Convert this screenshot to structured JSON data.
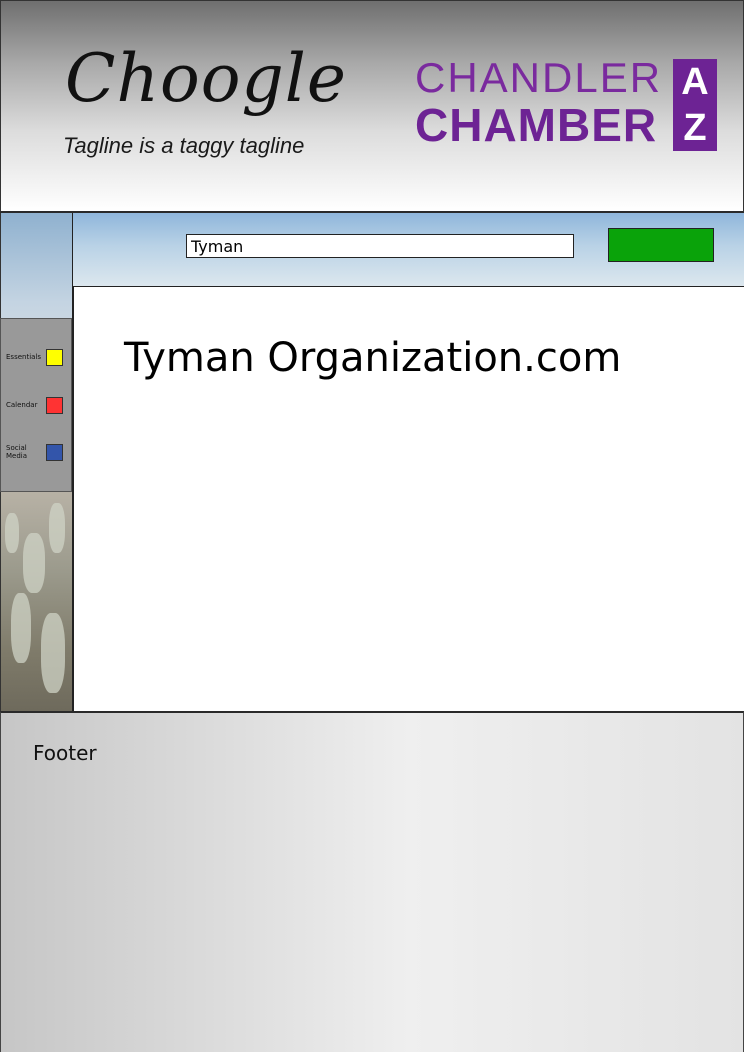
{
  "header": {
    "site_title": "Choogle",
    "tagline": "Tagline is a taggy tagline",
    "brand": {
      "line1": "CHANDLER",
      "line2": "CHAMBER",
      "az_top": "A",
      "az_bottom": "Z",
      "color": "#6d2394"
    }
  },
  "search": {
    "value": "Tyman",
    "button_color": "#0aa30a"
  },
  "sidebar": {
    "items": [
      {
        "label": "Essentials",
        "color": "#ffff00"
      },
      {
        "label": "Calendar",
        "color": "#ff3333"
      },
      {
        "label": "Social Media",
        "color": "#3355aa"
      }
    ]
  },
  "main": {
    "heading": "Tyman Organization.com"
  },
  "footer": {
    "text": "Footer"
  }
}
